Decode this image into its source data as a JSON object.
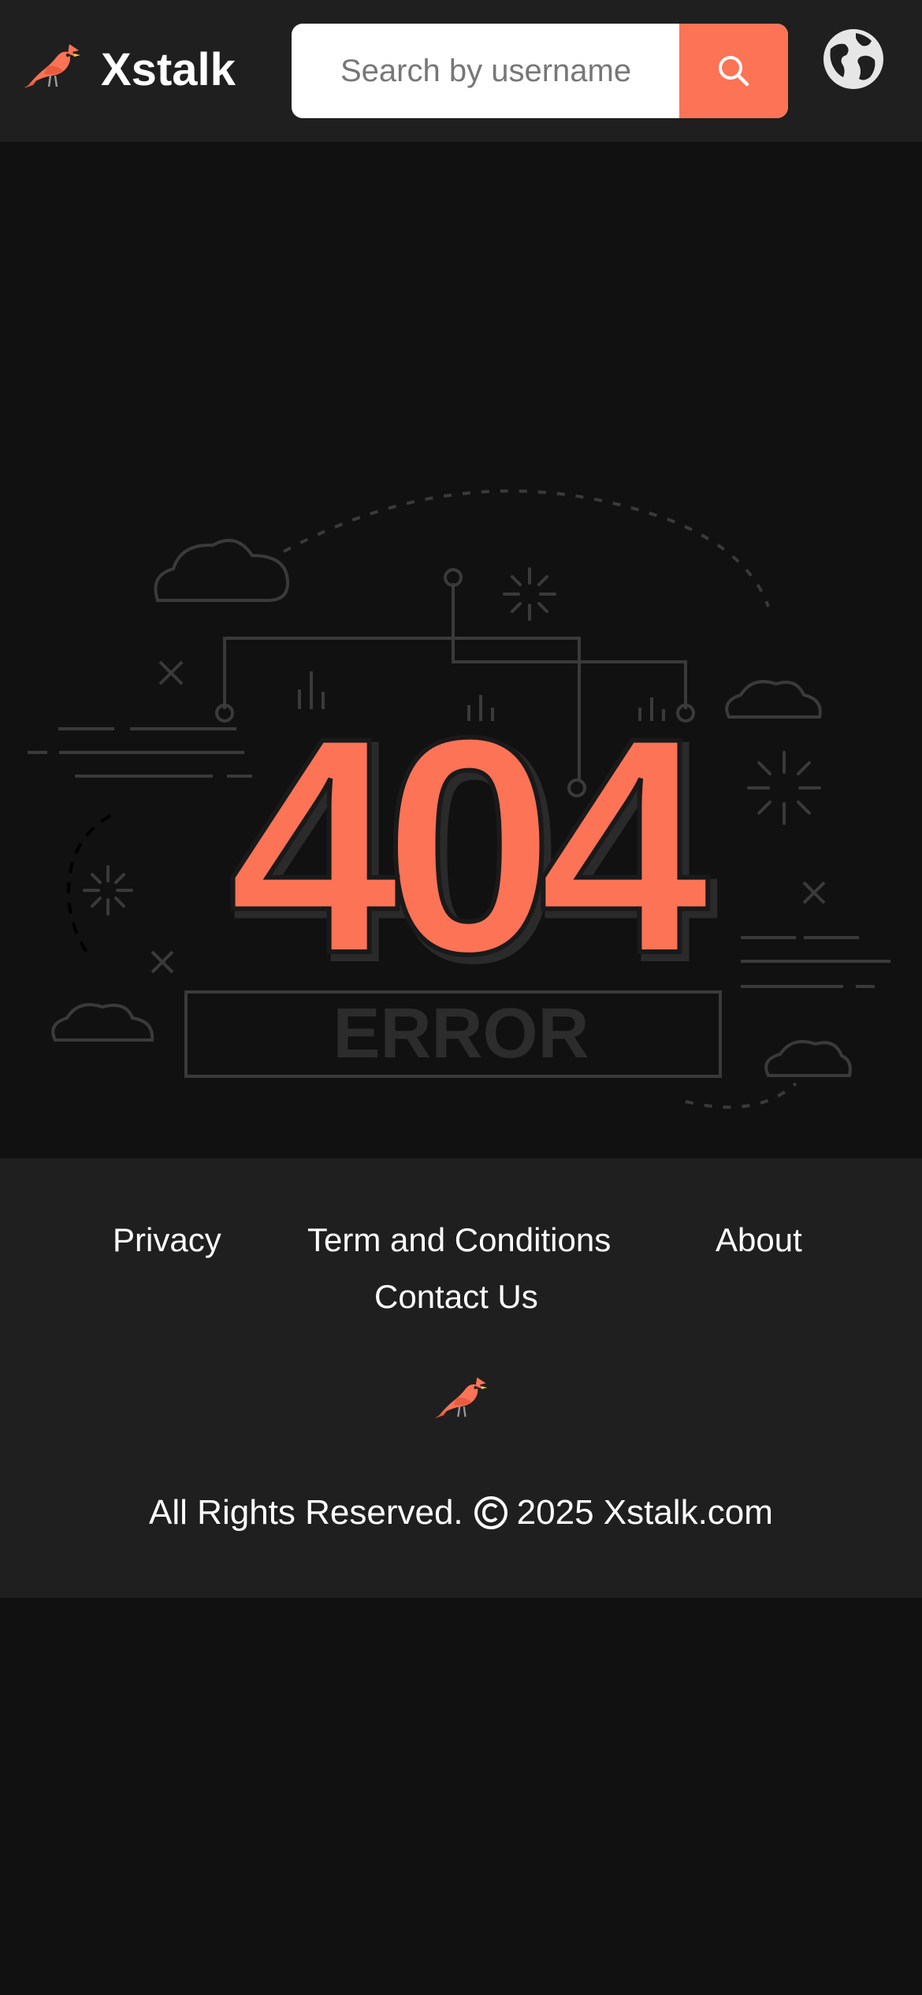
{
  "header": {
    "brand": "Xstalk",
    "search": {
      "placeholder": "Search by username",
      "value": ""
    },
    "icons": {
      "logo": "cardinal-bird-icon",
      "search": "search-icon",
      "language": "globe-icon"
    }
  },
  "main": {
    "error_code": "404",
    "error_word": "ERROR"
  },
  "footer": {
    "links": {
      "privacy": "Privacy",
      "terms": "Term and Conditions",
      "about": "About",
      "contact": "Contact Us"
    },
    "copyright": {
      "prefix": "All Rights Reserved.",
      "suffix": "2025 Xstalk.com"
    }
  },
  "colors": {
    "accent": "#fc7356",
    "header_bg": "#1f1f1f",
    "page_bg": "#111111",
    "footer_bg": "#1f1f1f"
  }
}
